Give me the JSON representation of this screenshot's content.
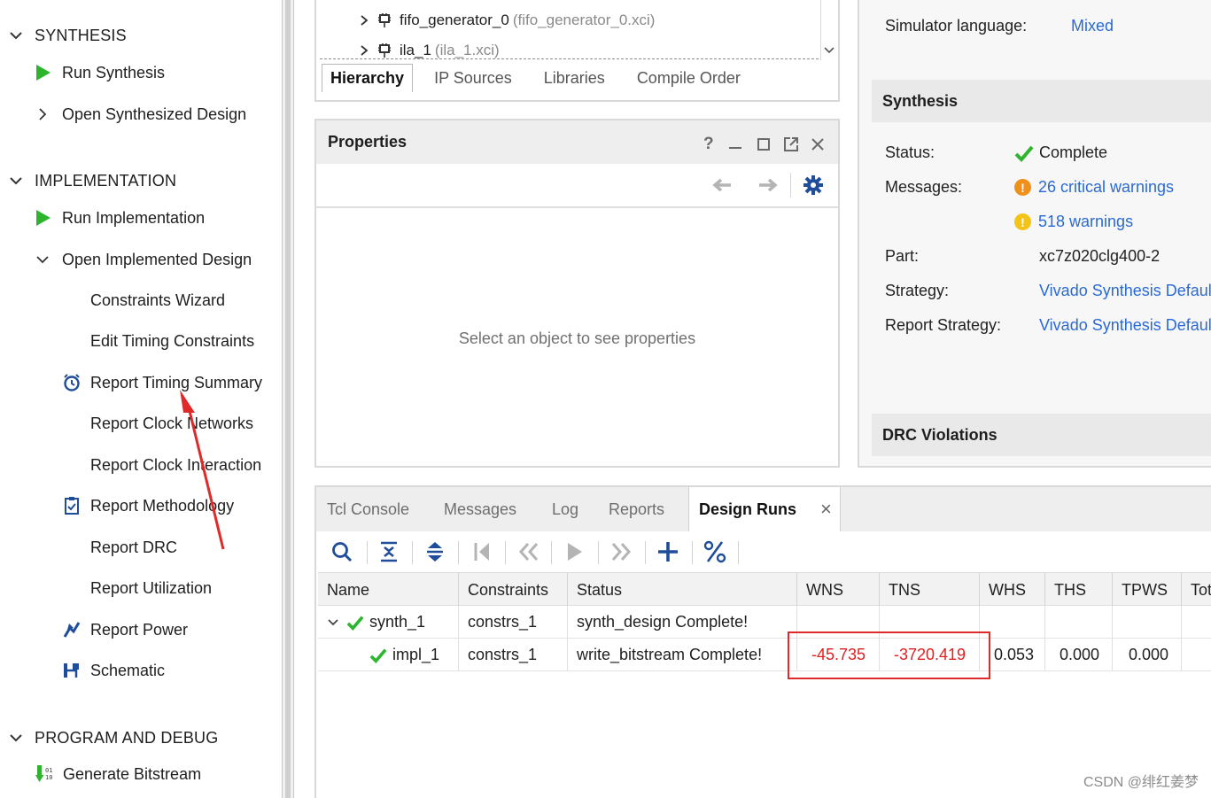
{
  "flow_navigator": {
    "sections": [
      {
        "title": "SYNTHESIS",
        "items": [
          {
            "label": "Run Synthesis",
            "icon": "run-icon"
          },
          {
            "label": "Open Synthesized Design",
            "icon": "chevron-right-icon"
          }
        ]
      },
      {
        "title": "IMPLEMENTATION",
        "items": [
          {
            "label": "Run Implementation",
            "icon": "run-icon"
          },
          {
            "label": "Open Implemented Design",
            "icon": "chevron-down-icon"
          },
          {
            "label": "Constraints Wizard"
          },
          {
            "label": "Edit Timing Constraints"
          },
          {
            "label": "Report Timing Summary",
            "icon": "stopwatch-icon"
          },
          {
            "label": "Report Clock Networks"
          },
          {
            "label": "Report Clock Interaction"
          },
          {
            "label": "Report Methodology",
            "icon": "clipboard-icon"
          },
          {
            "label": "Report DRC"
          },
          {
            "label": "Report Utilization"
          },
          {
            "label": "Report Power",
            "icon": "power-icon"
          },
          {
            "label": "Schematic",
            "icon": "schematic-icon"
          }
        ]
      },
      {
        "title": "PROGRAM AND DEBUG",
        "items": [
          {
            "label": "Generate Bitstream",
            "icon": "bitstream-icon"
          }
        ]
      }
    ]
  },
  "sources": {
    "tree": [
      {
        "name": "fifo_generator_0",
        "file": "(fifo_generator_0.xci)"
      },
      {
        "name": "ila_1",
        "file": "(ila_1.xci)"
      }
    ],
    "tabs": [
      "Hierarchy",
      "IP Sources",
      "Libraries",
      "Compile Order"
    ],
    "active_tab": "Hierarchy"
  },
  "properties": {
    "title": "Properties",
    "help": "?",
    "empty_text": "Select an object to see properties"
  },
  "summary": {
    "simulator_language_label": "Simulator language:",
    "simulator_language_value": "Mixed",
    "synthesis": {
      "title": "Synthesis",
      "status_label": "Status:",
      "status_value": "Complete",
      "messages_label": "Messages:",
      "critical_warnings": "26 critical warnings",
      "warnings": "518 warnings",
      "part_label": "Part:",
      "part_value": "xc7z020clg400-2",
      "strategy_label": "Strategy:",
      "strategy_value": "Vivado Synthesis Defaults",
      "report_strategy_label": "Report Strategy:",
      "report_strategy_value": "Vivado Synthesis Defaults"
    },
    "drc_title": "DRC Violations"
  },
  "bottom_panel": {
    "tabs": [
      "Tcl Console",
      "Messages",
      "Log",
      "Reports",
      "Design Runs"
    ],
    "active_tab": "Design Runs",
    "close": "×",
    "columns": [
      "Name",
      "Constraints",
      "Status",
      "WNS",
      "TNS",
      "WHS",
      "THS",
      "TPWS",
      "Tot"
    ],
    "runs": [
      {
        "name": "synth_1",
        "constraints": "constrs_1",
        "status": "synth_design Complete!",
        "wns": "",
        "tns": "",
        "whs": "",
        "ths": "",
        "tpws": ""
      },
      {
        "name": "impl_1",
        "constraints": "constrs_1",
        "status": "write_bitstream Complete!",
        "wns": "-45.735",
        "tns": "-3720.419",
        "whs": "0.053",
        "ths": "0.000",
        "tpws": "0.000"
      }
    ]
  },
  "colors": {
    "accent_green": "#2db52d",
    "link_blue": "#2a6ad6",
    "negative_red": "#e02020",
    "annotation_red": "#e02a2a",
    "critical_orange": "#f0901c",
    "warning_yellow": "#f3c318"
  },
  "watermark": "CSDN @绯红姜梦"
}
